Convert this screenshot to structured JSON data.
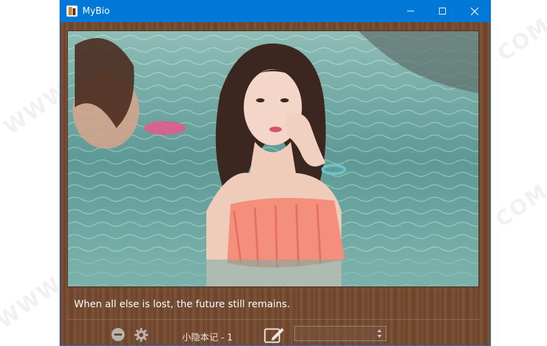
{
  "window": {
    "title": "MyBio",
    "controls": {
      "minimize": "minimize-icon",
      "maximize": "maximize-icon",
      "close": "close-icon"
    }
  },
  "content": {
    "quote": "When all else is lost, the future still remains."
  },
  "bottombar": {
    "remove_icon": "minus-circle-icon",
    "settings_icon": "gear-icon",
    "note_label": "小隐本记 - 1",
    "edit_icon": "edit-note-icon",
    "dropdown_value": ""
  },
  "colors": {
    "titlebar": "#0078d7",
    "wood": "#73492f",
    "quote_text": "#ffffff"
  }
}
